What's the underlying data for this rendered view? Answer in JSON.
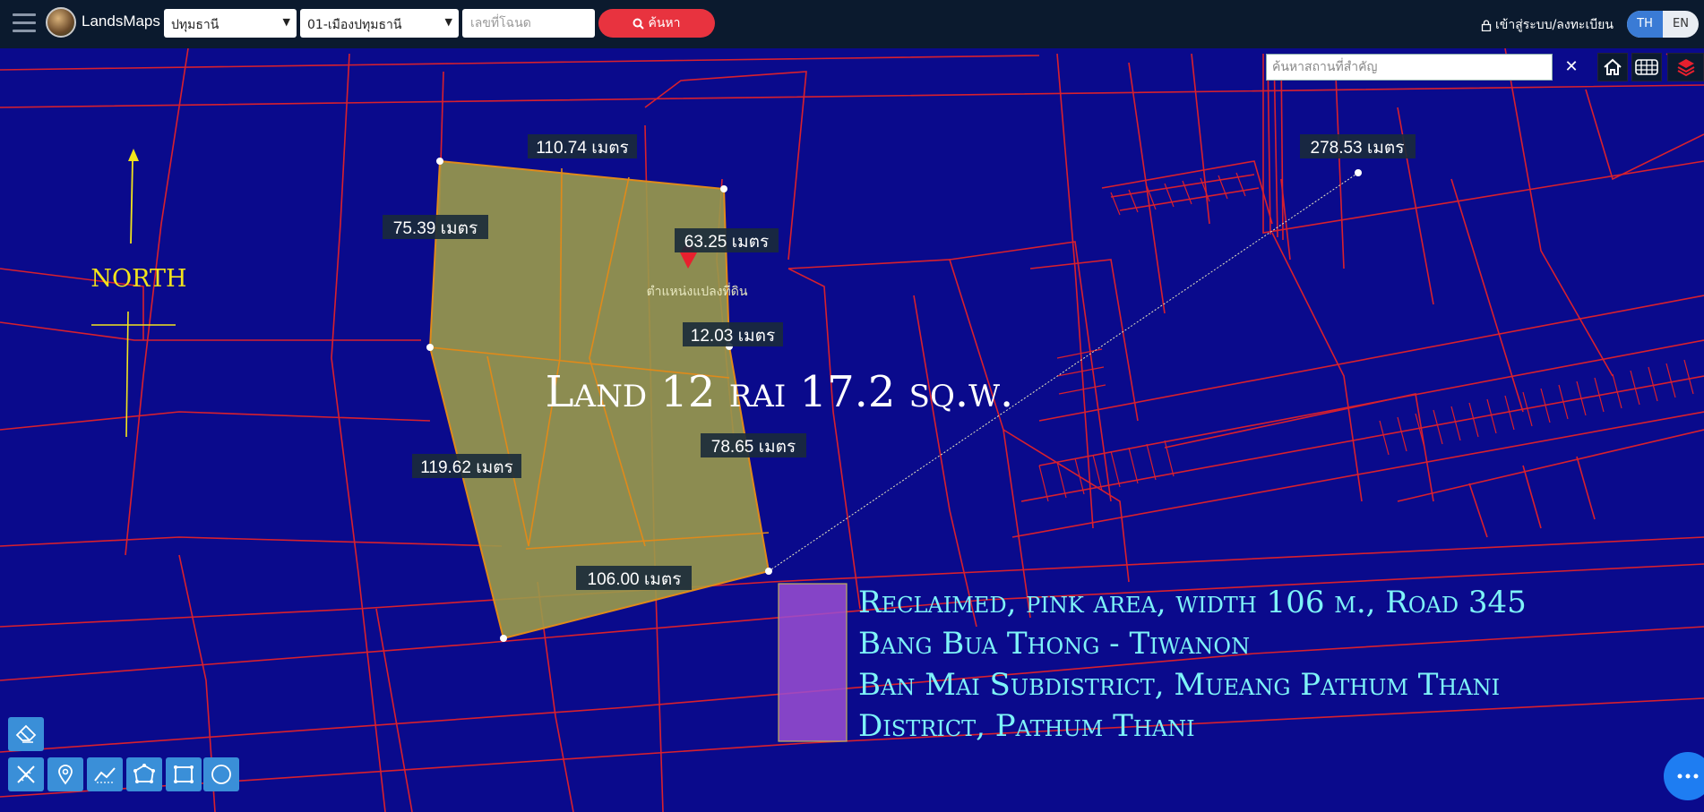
{
  "header": {
    "brand": "LandsMaps",
    "province": "ปทุมธานี",
    "district": "01-เมืองปทุมธานี",
    "deed_placeholder": "เลขที่โฉนด",
    "search_label": "ค้นหา",
    "login_label": "เข้าสู่ระบบ/ลงทะเบียน",
    "lang_th": "TH",
    "lang_en": "EN"
  },
  "map_search": {
    "placeholder": "ค้นหาสถานที่สำคัญ",
    "clear": "✕"
  },
  "map": {
    "north_label": "NORTH",
    "marker_label": "ตำแหน่งแปลงที่ดิน",
    "title": "Land 12 rai 17.2 sq.w.",
    "info_lines": [
      "Reclaimed, pink area, width 106 m., Road 345",
      "Bang Bua Thong - Tiwanon",
      "Ban Mai Subdistrict, Mueang Pathum Thani",
      "District, Pathum Thani"
    ],
    "measurements": {
      "top": "110.74 เมตร",
      "left_upper": "75.39 เมตร",
      "right_upper": "63.25 เมตร",
      "right_step": "12.03 เมตร",
      "right_lower": "78.65 เมตร",
      "left_lower": "119.62 เมตร",
      "bottom": "106.00 เมตร",
      "distance": "278.53 เมตร"
    }
  },
  "colors": {
    "map_bg": "#0a0a8c",
    "parcel_lines": "#d8202e",
    "plot_fill": "#9a9a4a",
    "plot_edges": "#e08a1a",
    "road_highlight": "#9b4fd1",
    "info_text": "#7ef3f8",
    "north_color": "#f2e41c",
    "search_button": "#e8333f"
  }
}
